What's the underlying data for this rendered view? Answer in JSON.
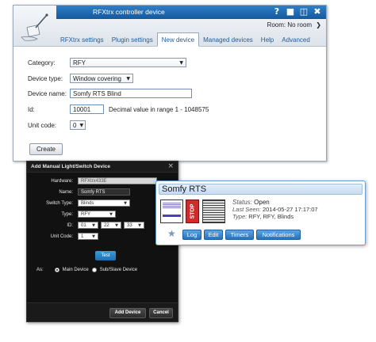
{
  "main_window": {
    "title": "RFXtrx controller device",
    "titlebar_icons": [
      "help-icon",
      "save-icon",
      "trash-icon",
      "close-icon"
    ],
    "room": {
      "label": "Room:",
      "value": "No room"
    },
    "tabs": [
      {
        "label": "RFXtrx settings",
        "active": false
      },
      {
        "label": "Plugin settings",
        "active": false
      },
      {
        "label": "New device",
        "active": true
      },
      {
        "label": "Managed devices",
        "active": false
      },
      {
        "label": "Help",
        "active": false
      },
      {
        "label": "Advanced",
        "active": false
      }
    ],
    "form": {
      "category": {
        "label": "Category:",
        "value": "RFY"
      },
      "device_type": {
        "label": "Device type:",
        "value": "Window covering"
      },
      "device_name": {
        "label": "Device name:",
        "value": "Somfy RTS Blind"
      },
      "id": {
        "label": "Id:",
        "value": "10001",
        "hint": "Decimal value in range 1 - 1048575"
      },
      "unit_code": {
        "label": "Unit code:",
        "value": "0"
      },
      "create_label": "Create"
    }
  },
  "dialog": {
    "title": "Add Manual Light/Switch Device",
    "fields": {
      "hardware": {
        "label": "Hardware:",
        "value": "RFXtrx433E"
      },
      "name": {
        "label": "Name:",
        "value": "Somfy RTS"
      },
      "switch_type": {
        "label": "Switch Type:",
        "value": "Blinds"
      },
      "type": {
        "label": "Type:",
        "value": "RFY"
      },
      "id": {
        "label": "ID:",
        "values": [
          "01",
          "22",
          "33"
        ]
      },
      "unit_code": {
        "label": "Unit Code:",
        "value": "1"
      }
    },
    "test_label": "Test",
    "as": {
      "label": "As:",
      "main_device": "Main Device",
      "sub_device": "Sub/Slave Device",
      "selected": "main"
    },
    "add_label": "Add Device",
    "cancel_label": "Cancel"
  },
  "device_widget": {
    "title": "Somfy RTS",
    "stop_label": "STOP",
    "status_key": "Status:",
    "status_value": "Open",
    "last_seen_key": "Last Seen:",
    "last_seen_value": "2014-05-27 17:17:07",
    "type_key": "Type:",
    "type_value": "RFY, RFY, Blinds",
    "buttons": [
      "Log",
      "Edit",
      "Timers",
      "Notifications"
    ]
  },
  "colors": {
    "titlebar": "#1f6db4",
    "tab_text": "#1e5c9e",
    "dialog_bg": "#111111",
    "widget_button": "#2f80c8",
    "stop": "#cf2b2b"
  }
}
